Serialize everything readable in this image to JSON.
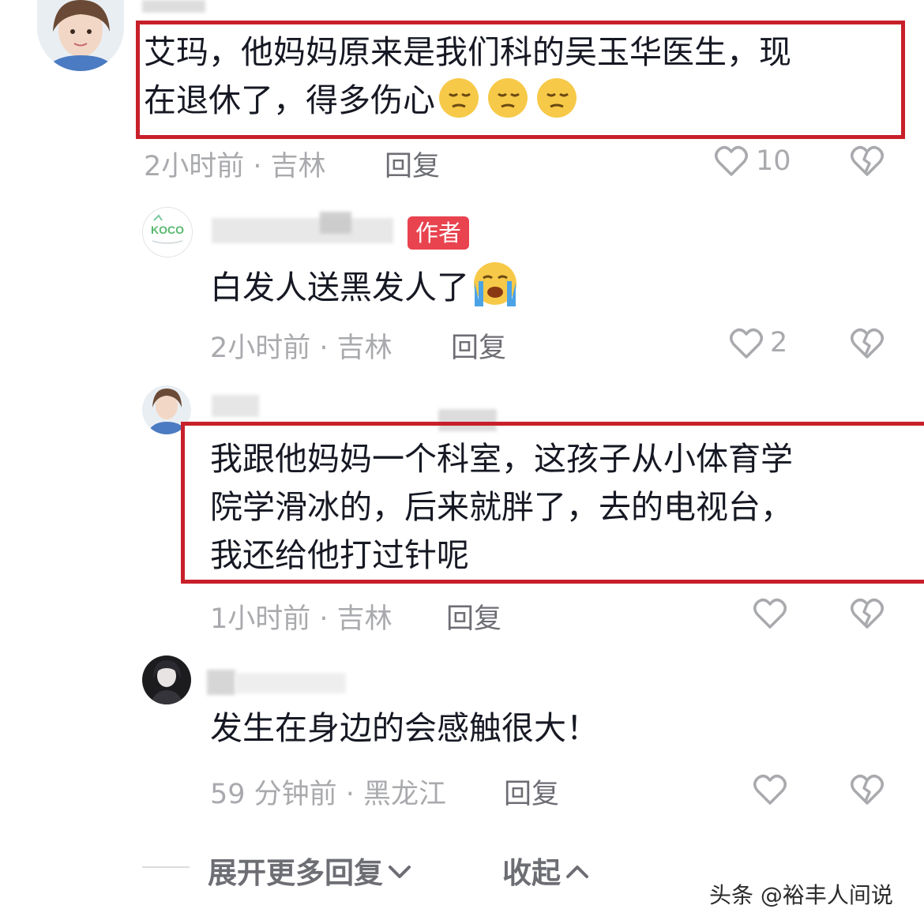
{
  "comments": [
    {
      "text_lines": [
        "艾玛，他妈妈原来是我们科的吴玉华医生，现",
        "在退休了，得多伤心"
      ],
      "emoji": "pensive-face x3",
      "time_location": "2小时前 · 吉林",
      "reply_label": "回复",
      "likes": "10"
    },
    {
      "author_badge": "作者",
      "text": "白发人送黑发人了",
      "emoji": "crying-face",
      "time_location": "2小时前 · 吉林",
      "reply_label": "回复",
      "likes": "2"
    },
    {
      "text_lines": [
        "我跟他妈妈一个科室，这孩子从小体育学",
        "院学滑冰的，后来就胖了，去的电视台，",
        "我还给他打过针呢"
      ],
      "time_location": "1小时前 · 吉林",
      "reply_label": "回复"
    },
    {
      "text": "发生在身边的会感触很大！",
      "time_location": "59 分钟前 · 黑龙江",
      "reply_label": "回复"
    }
  ],
  "avatar2_logo": "KOCO",
  "footer": {
    "expand_label": "展开更多回复",
    "collapse_label": "收起"
  },
  "watermark": "头条 @裕丰人间说",
  "colors": {
    "highlight_box": "#c8202a",
    "badge": "#e8434f",
    "meta_gray": "#a9aaad"
  }
}
